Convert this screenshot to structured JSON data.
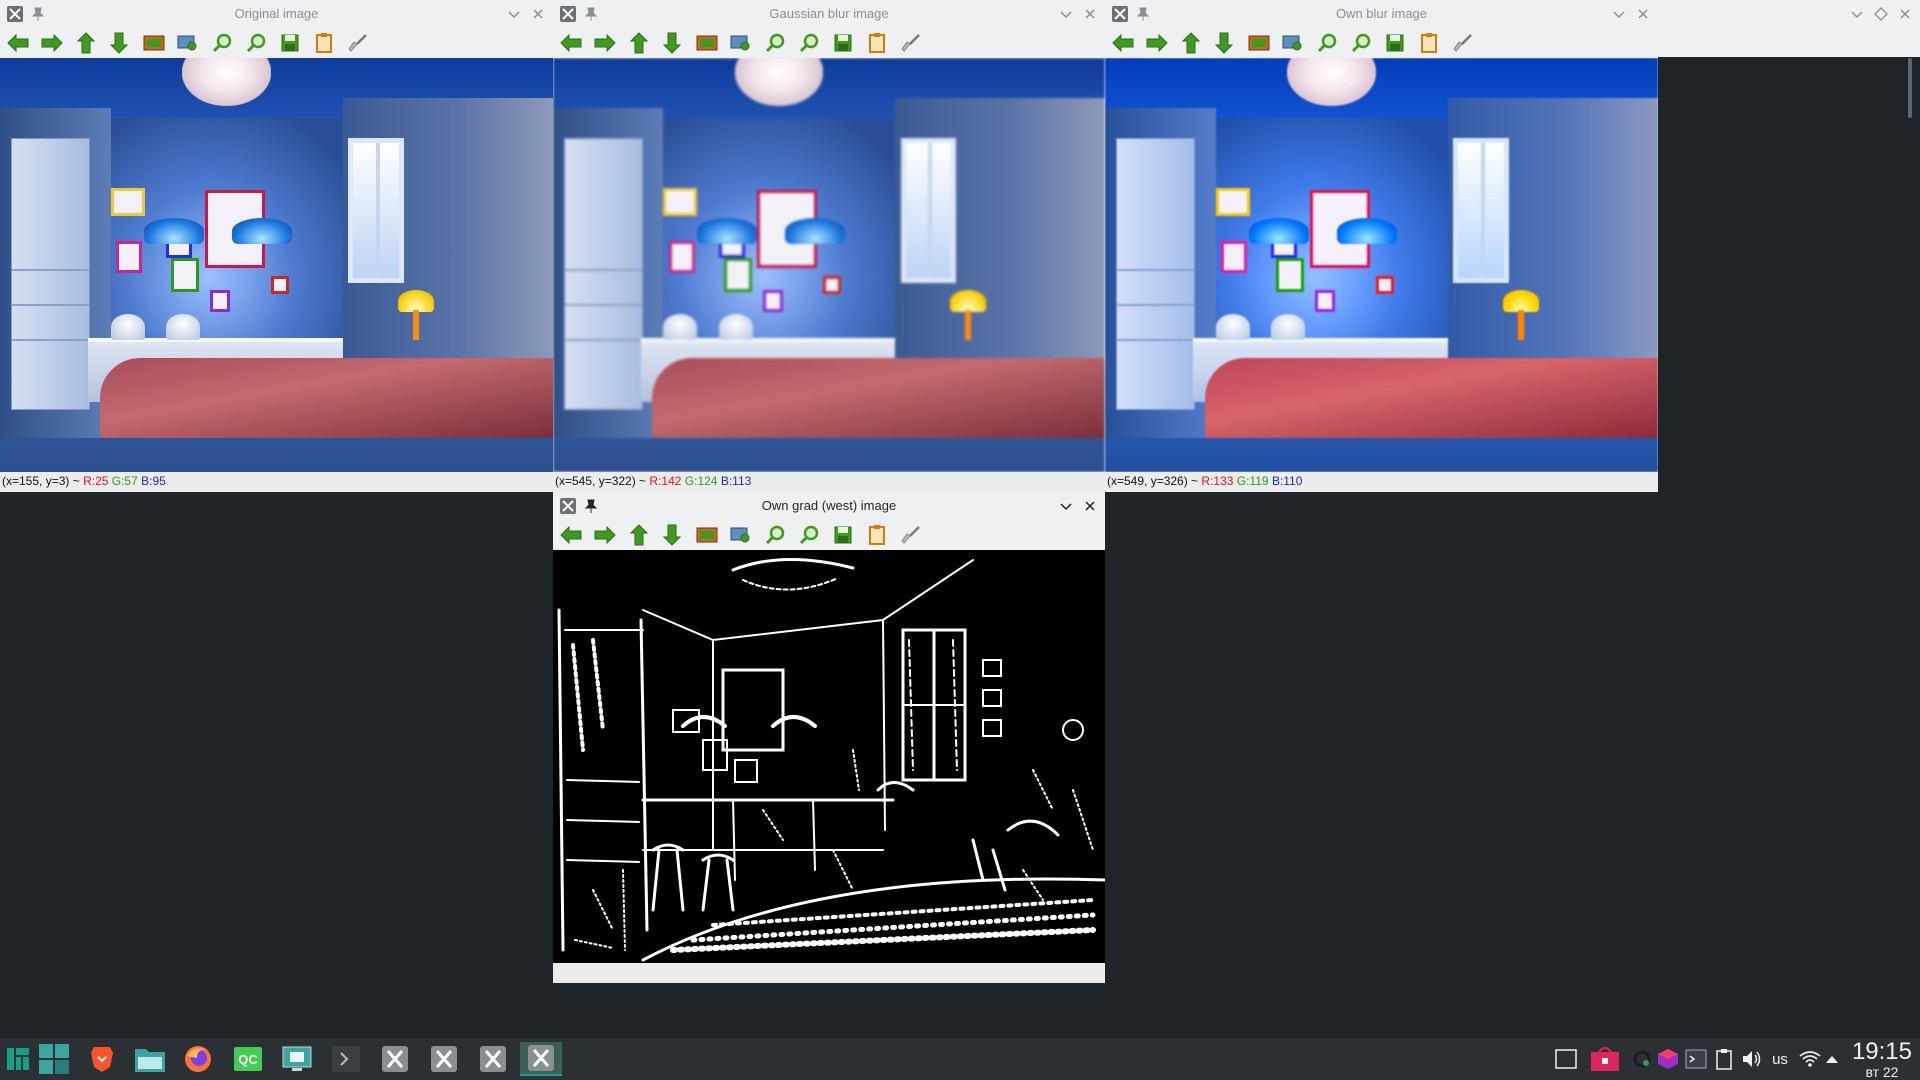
{
  "windows": [
    {
      "id": "original",
      "title": "Original image",
      "active": false,
      "status": {
        "coords": "(x=155, y=3) ~",
        "r": "R:25",
        "g": "G:57",
        "b": "B:95"
      }
    },
    {
      "id": "gaussian",
      "title": "Gaussian blur image",
      "active": false,
      "status": {
        "coords": "(x=545, y=322) ~",
        "r": "R:142",
        "g": "G:124",
        "b": "B:113"
      }
    },
    {
      "id": "ownblur",
      "title": "Own blur image",
      "active": false,
      "status": {
        "coords": "(x=549, y=326) ~",
        "r": "R:133",
        "g": "G:119",
        "b": "B:110"
      }
    },
    {
      "id": "owngrad",
      "title": "Own grad (west) image",
      "active": true,
      "status": {
        "coords": "",
        "r": "",
        "g": "",
        "b": ""
      }
    }
  ],
  "toolbar_buttons": [
    {
      "icon": "arrow-left-icon",
      "tooltip": "Panning left"
    },
    {
      "icon": "arrow-right-icon",
      "tooltip": "Panning right"
    },
    {
      "icon": "arrow-up-icon",
      "tooltip": "Panning up"
    },
    {
      "icon": "arrow-down-icon",
      "tooltip": "Panning down"
    },
    {
      "icon": "zoom-reset-icon",
      "tooltip": "Zoom x1"
    },
    {
      "icon": "zoom-fit-icon",
      "tooltip": "Zoom fit"
    },
    {
      "icon": "zoom-in-icon",
      "tooltip": "Zoom in"
    },
    {
      "icon": "zoom-out-icon",
      "tooltip": "Zoom out"
    },
    {
      "icon": "save-icon",
      "tooltip": "Save"
    },
    {
      "icon": "properties-icon",
      "tooltip": "Properties"
    },
    {
      "icon": "clear-icon",
      "tooltip": "Clear"
    }
  ],
  "taskbar": {
    "apps": [
      {
        "name": "manjaro-menu"
      },
      {
        "name": "show-desktop"
      },
      {
        "name": "brave-browser"
      },
      {
        "name": "file-manager"
      },
      {
        "name": "firefox"
      },
      {
        "name": "qt-creator",
        "label": "QC"
      },
      {
        "name": "screenshot-tool"
      },
      {
        "name": "terminal"
      },
      {
        "name": "opencv-window-1"
      },
      {
        "name": "opencv-window-2"
      },
      {
        "name": "opencv-window-3"
      },
      {
        "name": "opencv-window-4",
        "active": true
      }
    ],
    "tray": {
      "keyboard_layout": "us"
    },
    "clock": {
      "time": "19:15",
      "date": "вт 22"
    }
  },
  "colors": {
    "desktop": "#1f2429",
    "taskbar": "#2b3035",
    "toolbar_green": "#3f9b1f",
    "accent": "#16a085"
  }
}
